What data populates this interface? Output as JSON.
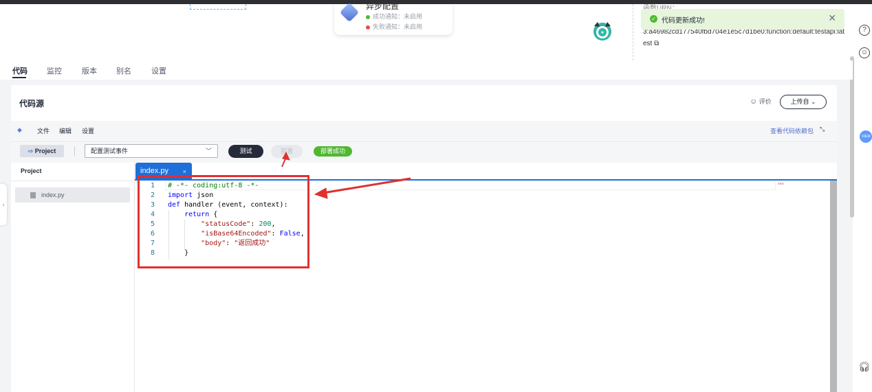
{
  "async_config": {
    "title": "异步配置",
    "success_notice": "成功通知：未启用",
    "failure_notice": "失败通知：未启用"
  },
  "urn": {
    "label": "函数URN：",
    "value_line1": "3:a46982cd177540fbd704e1e5c7d1be0:function:default:testapi:lat",
    "value_line2": "est"
  },
  "toast": {
    "message": "代码更新成功!",
    "close": "✕"
  },
  "tabs": [
    "代码",
    "监控",
    "版本",
    "别名",
    "设置"
  ],
  "section": {
    "title": "代码源",
    "rate": "评价",
    "upload": "上传自"
  },
  "menubar": {
    "items": [
      "文件",
      "编辑",
      "设置"
    ],
    "dependency_link": "查看代码依赖包"
  },
  "toolbar": {
    "project": "Project",
    "test_event": "配置测试事件",
    "test": "测试",
    "deploy": "部署",
    "deploy_status": "部署成功"
  },
  "project_panel": {
    "title": "Project",
    "file": "index.py"
  },
  "editor": {
    "tab": "index.py",
    "tab_close": "×",
    "line_numbers": [
      "1",
      "2",
      "3",
      "4",
      "5",
      "6",
      "7",
      "8"
    ]
  },
  "right_rail": {
    "badge": "10EM"
  },
  "colors": {
    "accent": "#1e6fd9",
    "success": "#50b830",
    "highlight": "#e03030"
  }
}
